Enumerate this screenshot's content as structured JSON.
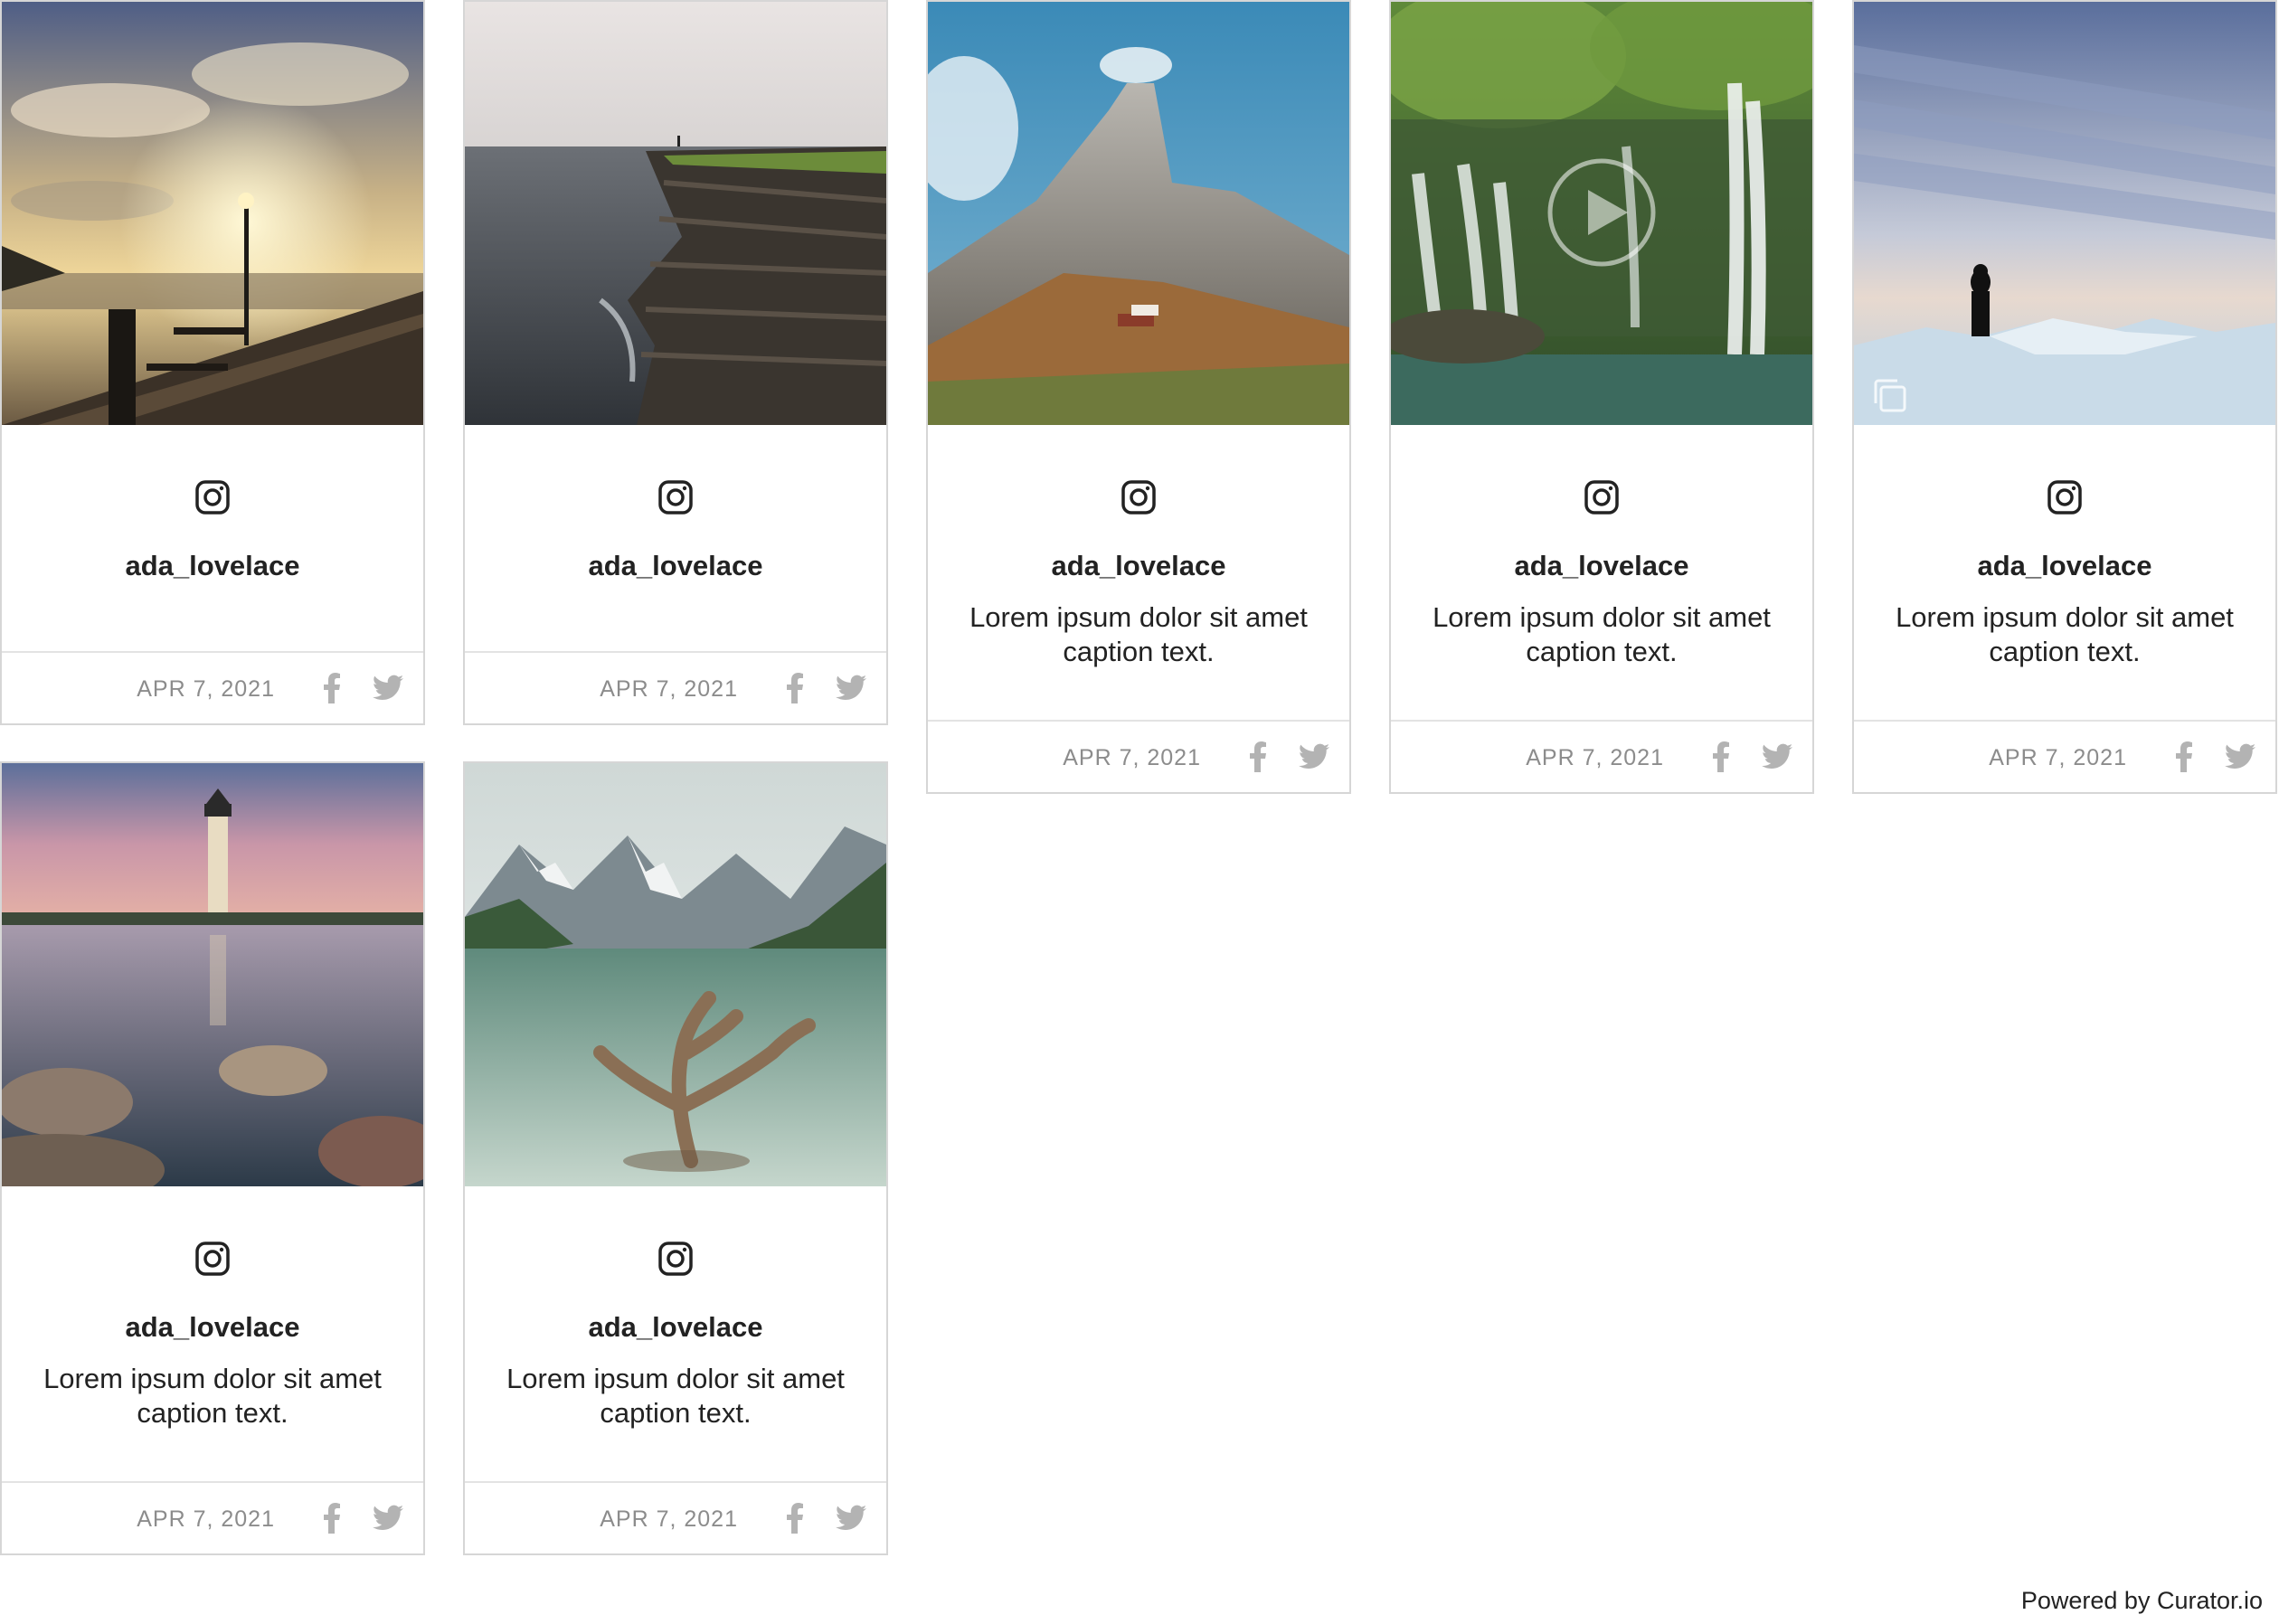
{
  "cards": [
    {
      "username": "ada_lovelace",
      "caption": "",
      "date": "APR 7, 2021",
      "photo": "pier-sunset",
      "network_icon": "instagram-icon"
    },
    {
      "username": "ada_lovelace",
      "caption": "",
      "date": "APR 7, 2021",
      "photo": "sea-cliff",
      "network_icon": "instagram-icon"
    },
    {
      "username": "ada_lovelace",
      "caption": "Lorem ipsum dolor sit amet caption text.",
      "date": "APR 7, 2021",
      "photo": "mountain-peak",
      "network_icon": "instagram-icon"
    },
    {
      "username": "ada_lovelace",
      "caption": "Lorem ipsum dolor sit amet caption text.",
      "date": "APR 7, 2021",
      "photo": "waterfall",
      "network_icon": "instagram-icon",
      "overlay_icon": "play-icon"
    },
    {
      "username": "ada_lovelace",
      "caption": "Lorem ipsum dolor sit amet caption text.",
      "date": "APR 7, 2021",
      "photo": "ice-figure",
      "network_icon": "instagram-icon",
      "overlay_icon": "gallery-icon"
    },
    {
      "username": "ada_lovelace",
      "caption": "Lorem ipsum dolor sit amet caption text.",
      "date": "APR 7, 2021",
      "photo": "lighthouse",
      "network_icon": "instagram-icon"
    },
    {
      "username": "ada_lovelace",
      "caption": "Lorem ipsum dolor sit amet caption text.",
      "date": "APR 7, 2021",
      "photo": "alpine-lake",
      "network_icon": "instagram-icon"
    }
  ],
  "share_icons": [
    "facebook-icon",
    "twitter-icon"
  ],
  "footer": {
    "powered_by": "Powered by Curator.io"
  },
  "colors": {
    "border": "#d6d6d6",
    "meta_text": "#8c8c8c",
    "share_icon": "#b3b3b3"
  }
}
